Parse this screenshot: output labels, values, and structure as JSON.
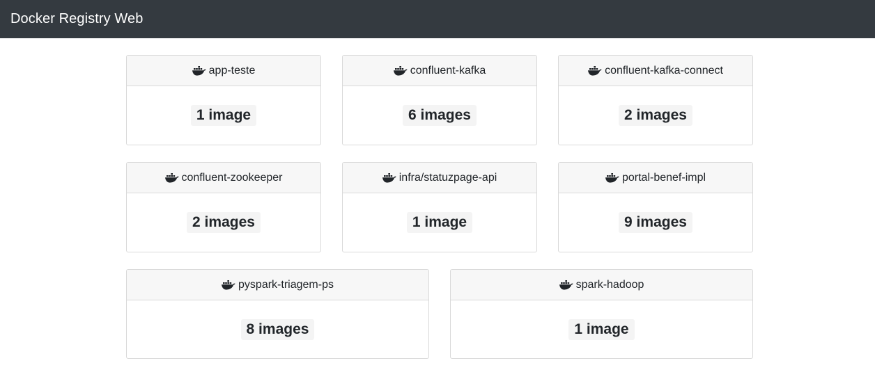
{
  "navbar": {
    "brand": "Docker Registry Web"
  },
  "repositories": [
    {
      "name": "app-teste",
      "count": "1 image",
      "icon": "docker-whale-icon"
    },
    {
      "name": "confluent-kafka",
      "count": "6 images",
      "icon": "docker-whale-icon"
    },
    {
      "name": "confluent-kafka-connect",
      "count": "2 images",
      "icon": "docker-whale-icon"
    },
    {
      "name": "confluent-zookeeper",
      "count": "2 images",
      "icon": "docker-whale-icon"
    },
    {
      "name": "infra/statuzpage-api",
      "count": "1 image",
      "icon": "docker-whale-icon"
    },
    {
      "name": "portal-benef-impl",
      "count": "9 images",
      "icon": "docker-whale-icon"
    },
    {
      "name": "pyspark-triagem-ps",
      "count": "8 images",
      "icon": "docker-whale-icon"
    },
    {
      "name": "spark-hadoop",
      "count": "1 image",
      "icon": "docker-whale-icon"
    }
  ],
  "colors": {
    "navbar_bg": "#343a40",
    "card_header_bg": "#f7f7f7",
    "badge_bg": "#f4f4f4"
  }
}
